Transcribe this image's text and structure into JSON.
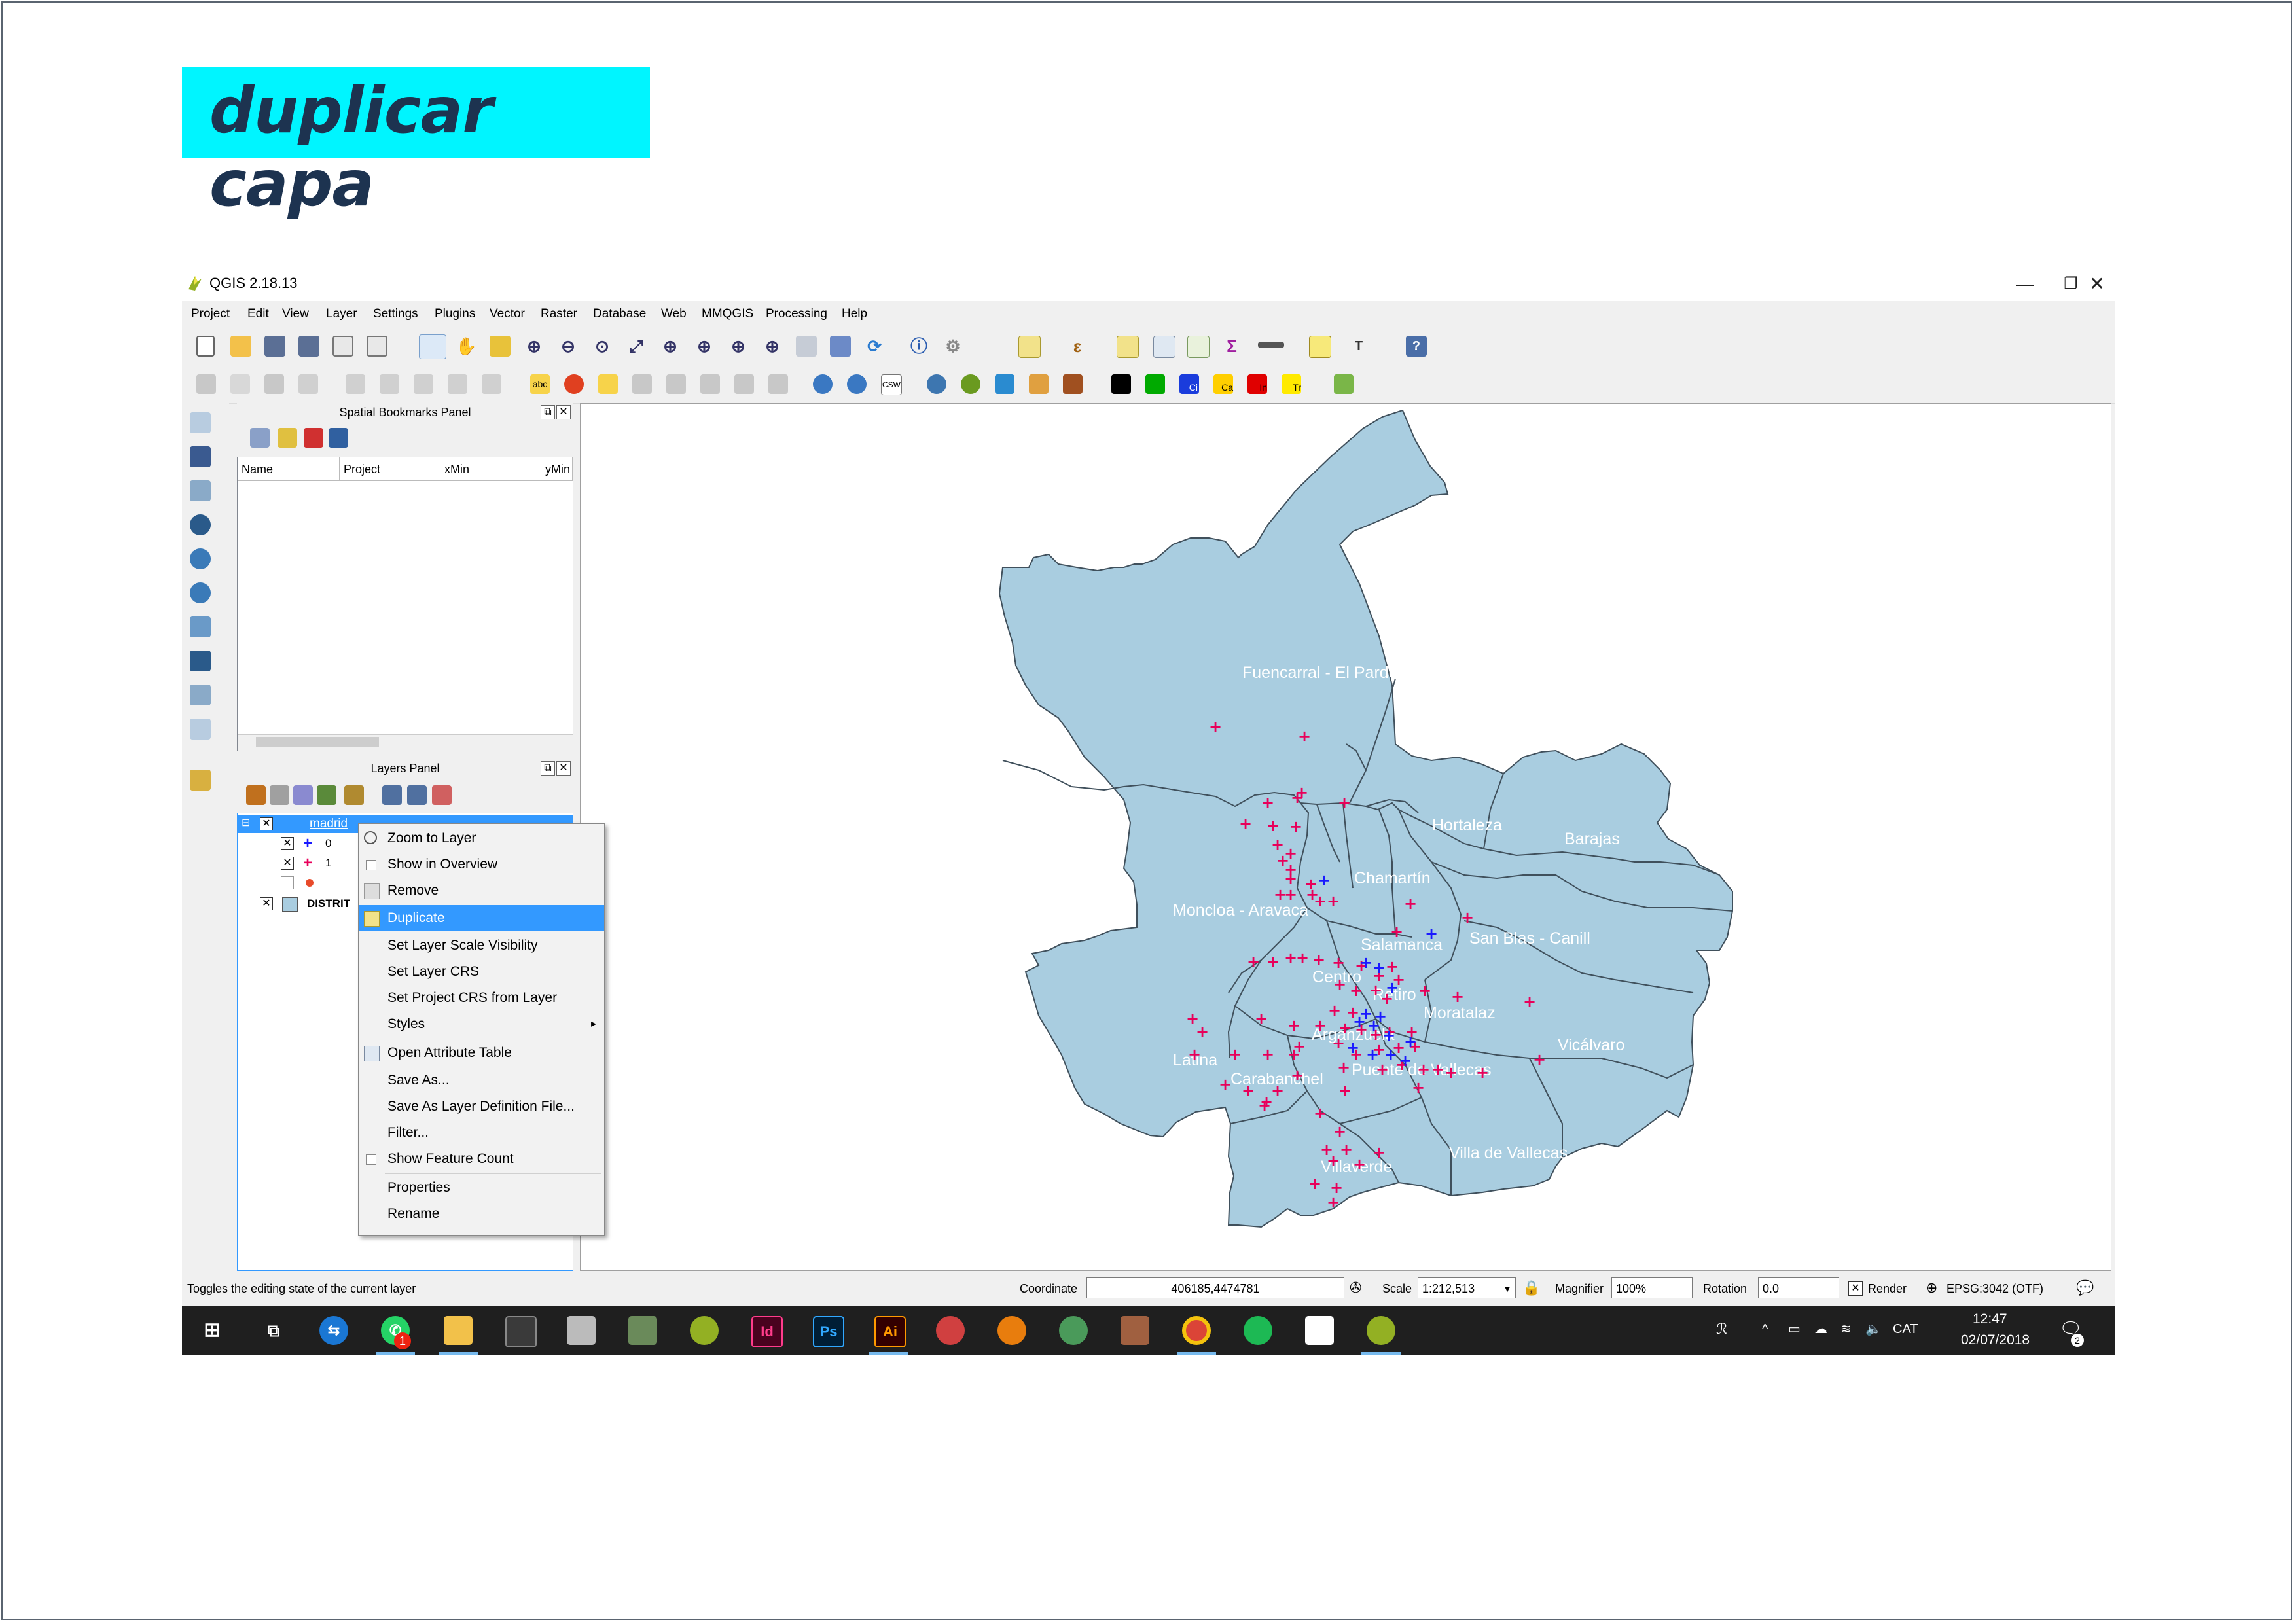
{
  "page_title": "duplicar capa",
  "window": {
    "title": "QGIS 2.18.13",
    "minimize": "—",
    "restore": "❐",
    "close": "✕"
  },
  "menubar": [
    "Project",
    "Edit",
    "View",
    "Layer",
    "Settings",
    "Plugins",
    "Vector",
    "Raster",
    "Database",
    "Web",
    "MMQGIS",
    "Processing",
    "Help"
  ],
  "toolbar_labels": {
    "csw": "CSW",
    "abc": "abc",
    "ci": "Ci",
    "ca": "Ca",
    "in": "In",
    "tr": "Tr"
  },
  "bookmarks_panel": {
    "title": "Spatial Bookmarks Panel",
    "columns": [
      "Name",
      "Project",
      "xMin",
      "yMin"
    ]
  },
  "layers_panel": {
    "title": "Layers Panel",
    "layers": [
      {
        "name": "madrid",
        "checked": true
      },
      {
        "name": "0",
        "checked": true
      },
      {
        "name": "1",
        "checked": true
      },
      {
        "name": "",
        "checked": false
      },
      {
        "name": "DISTRIT",
        "checked": true
      }
    ]
  },
  "context_menu": {
    "items": [
      "Zoom to Layer",
      "Show in Overview",
      "Remove",
      "Duplicate",
      "Set Layer Scale Visibility",
      "Set Layer CRS",
      "Set Project CRS from Layer",
      "Styles",
      "Open Attribute Table",
      "Save As...",
      "Save As Layer Definition File...",
      "Filter...",
      "Show Feature Count",
      "Properties",
      "Rename"
    ],
    "selected": "Duplicate",
    "submenu_arrow": "▸"
  },
  "map": {
    "fill_color": "#a9cde0",
    "line_color": "#40505c",
    "districts": [
      "Fuencarral - El Pardo",
      "Hortaleza",
      "Barajas",
      "Chamartín",
      "Moncloa - Aravaca",
      "San Blas - Canill",
      "Salamanca",
      "Centro",
      "Retiro",
      "Moratalaz",
      "Vicálvaro",
      "Arganzuela",
      "Latina",
      "Carabanchel",
      "Puente de Vallecas",
      "Villaverde",
      "Villa de Vallecas"
    ],
    "marker_red": "#e8005a",
    "marker_blue": "#1a1aff"
  },
  "status_bar": {
    "message": "Toggles the editing state of the current layer",
    "coordinate_label": "Coordinate",
    "coordinate_value": "406185,4474781",
    "scale_label": "Scale",
    "scale_value": "1:212,513",
    "magnifier_label": "Magnifier",
    "magnifier_value": "100%",
    "rotation_label": "Rotation",
    "rotation_value": "0.0",
    "render_label": "Render",
    "crs": "EPSG:3042 (OTF)"
  },
  "taskbar": {
    "apps": {
      "indesign": "Id",
      "photoshop": "Ps",
      "illustrator": "Ai"
    },
    "whatsapp_badge": "1",
    "language": "CAT",
    "time": "12:47",
    "date": "02/07/2018",
    "notification_count": "2"
  }
}
